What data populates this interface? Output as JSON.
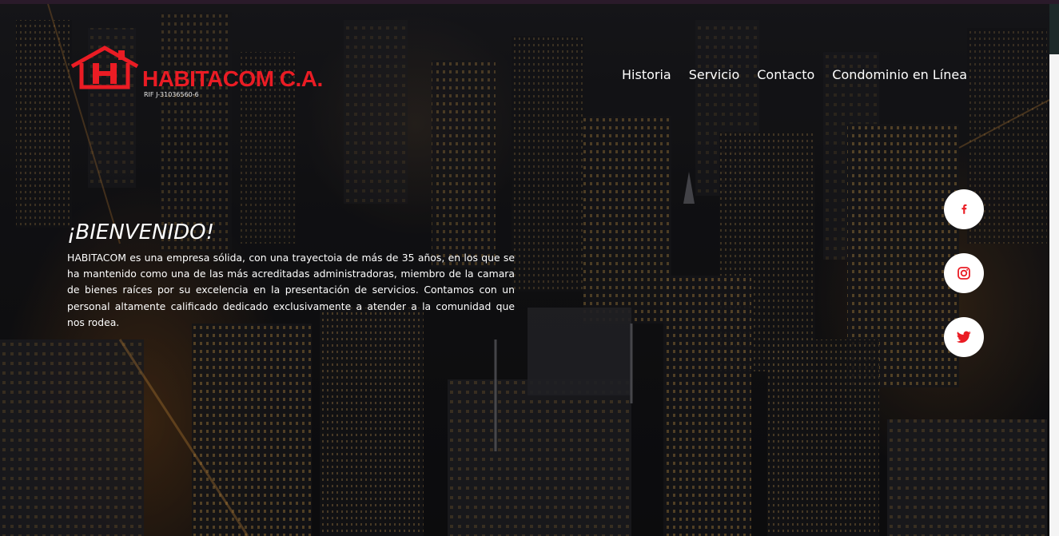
{
  "logo": {
    "brand": "HABITACOM C.A.",
    "rif": "RIF J-31036560-6"
  },
  "nav": {
    "items": [
      {
        "label": "Historia"
      },
      {
        "label": "Servicio"
      },
      {
        "label": "Contacto"
      },
      {
        "label": "Condominio en Línea"
      }
    ]
  },
  "welcome": {
    "heading": "¡BIENVENIDO!",
    "body": "HABITACOM es una empresa sólida, con una trayectoia de más de 35 años, en los que se ha mantenido como una de las más acreditadas administradoras, miembro de la camara de bienes raíces por su excelencia en la presentación de servicios. Contamos con un personal altamente calificado dedicado exclusivamente a atender a la comunidad que nos rodea."
  },
  "social": [
    {
      "icon": "facebook-icon"
    },
    {
      "icon": "instagram-icon"
    },
    {
      "icon": "twitter-icon"
    }
  ],
  "colors": {
    "brand_red": "#ea1c24",
    "text": "#ffffff",
    "social_bg": "#ffffff"
  }
}
